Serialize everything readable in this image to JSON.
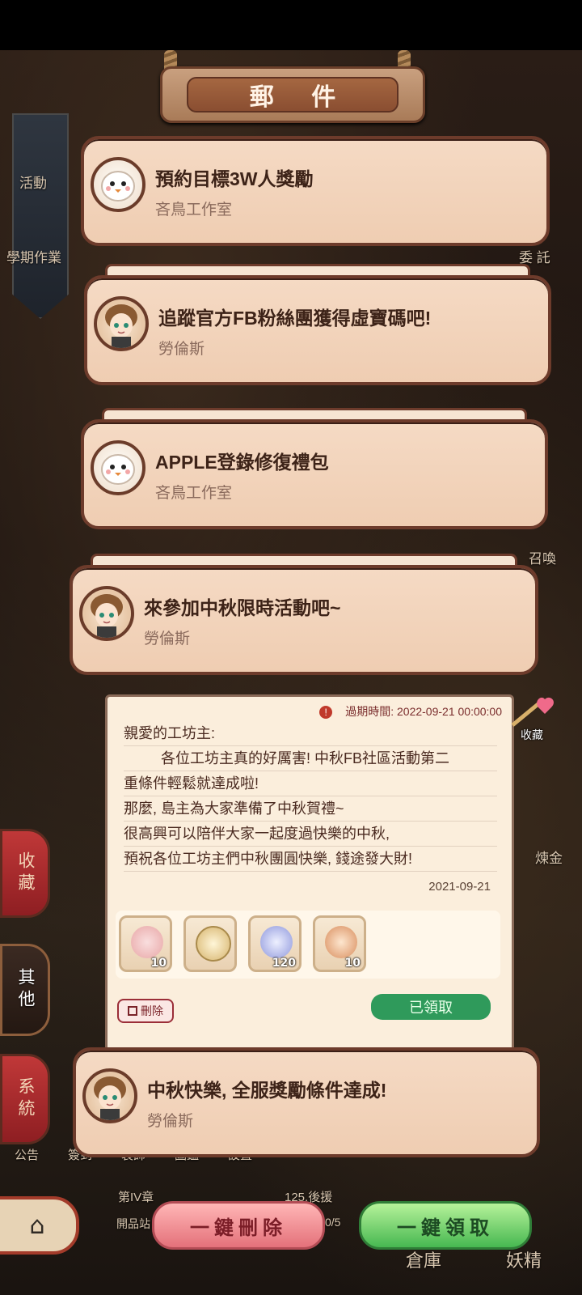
{
  "title": "郵 件",
  "background_labels": {
    "activity": "活動",
    "homework": "學期作業",
    "commission": "委 託",
    "summon": "召喚",
    "gold": "煉金",
    "notice": "公告",
    "checkin": "簽到",
    "outfit": "裝飾",
    "gallery": "圖鑑",
    "settings": "設置",
    "chapter": "第IV章",
    "chapter_progress": "125.後援",
    "chapter_sub": "開品站",
    "chapter_count": "0/5",
    "warehouse": "倉庫",
    "elf": "妖精"
  },
  "mails": [
    {
      "subject": "預約目標3W人獎勵",
      "sender": "吝鳥工作室",
      "avatar": "bird-avatar"
    },
    {
      "subject": "追蹤官方FB粉絲團獲得虛寶碼吧!",
      "sender": "勞倫斯",
      "avatar": "lawrence-avatar"
    },
    {
      "subject": "APPLE登錄修復禮包",
      "sender": "吝鳥工作室",
      "avatar": "bird-avatar"
    },
    {
      "subject": "來參加中秋限時活動吧~",
      "sender": "勞倫斯",
      "avatar": "lawrence-avatar"
    },
    {
      "subject": "中秋快樂, 全服獎勵條件達成!",
      "sender": "勞倫斯",
      "avatar": "lawrence-avatar"
    }
  ],
  "detail": {
    "expire_label": "過期時間: 2022-09-21 00:00:00",
    "lines": [
      "親愛的工坊主:",
      "各位工坊主真的好厲害! 中秋FB社區活動第二",
      "重條件輕鬆就達成啦!",
      "那麼, 島主為大家準備了中秋賀禮~",
      "很高興可以陪伴大家一起度過快樂的中秋,",
      "預祝各位工坊主們中秋團圓快樂, 錢途發大財!"
    ],
    "date": "2021-09-21",
    "rewards": [
      {
        "name": "flower-wand-icon",
        "qty": "10",
        "color": "#f2c6b8"
      },
      {
        "name": "gold-medal-icon",
        "qty": "",
        "color": "#e2c98f"
      },
      {
        "name": "hourglass-gem-icon",
        "qty": "120",
        "color": "#aeb6ee"
      },
      {
        "name": "mont-blanc-cake-icon",
        "qty": "10",
        "color": "#e2a07a"
      }
    ],
    "delete_label": "刪除",
    "claimed_label": "已領取"
  },
  "favorite_label": "收藏",
  "left_tabs": [
    {
      "label": "收藏"
    },
    {
      "label": "其他"
    },
    {
      "label": "系統"
    }
  ],
  "buttons": {
    "delete_all": "一鍵刪除",
    "claim_all": "一鍵領取"
  }
}
